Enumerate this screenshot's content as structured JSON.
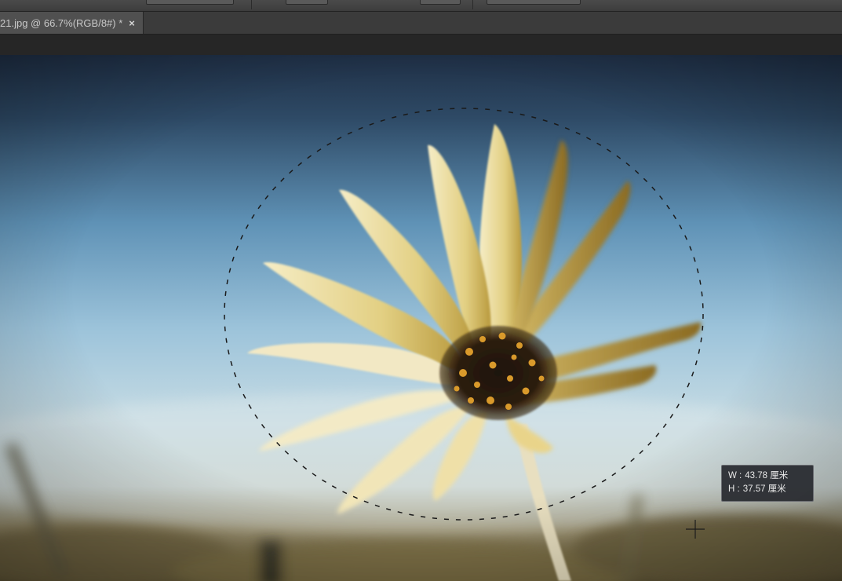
{
  "document": {
    "tab_title": "21.jpg @ 66.7%(RGB/8#) *",
    "close_glyph": "×"
  },
  "size_readout": {
    "w_label": "W :",
    "w_value": "43.78 厘米",
    "h_label": "H :",
    "h_value": "37.57 厘米"
  },
  "icons": {
    "crosshair": "crosshair-cursor-icon",
    "close": "close-icon"
  },
  "colors": {
    "sky_top": "#22344d",
    "sky_mid": "#7fb2d2",
    "sky_low": "#c9dde6",
    "petal": "#f0e4b0",
    "flower_center": "#2a1c0e",
    "pollen": "#d99a2b"
  }
}
